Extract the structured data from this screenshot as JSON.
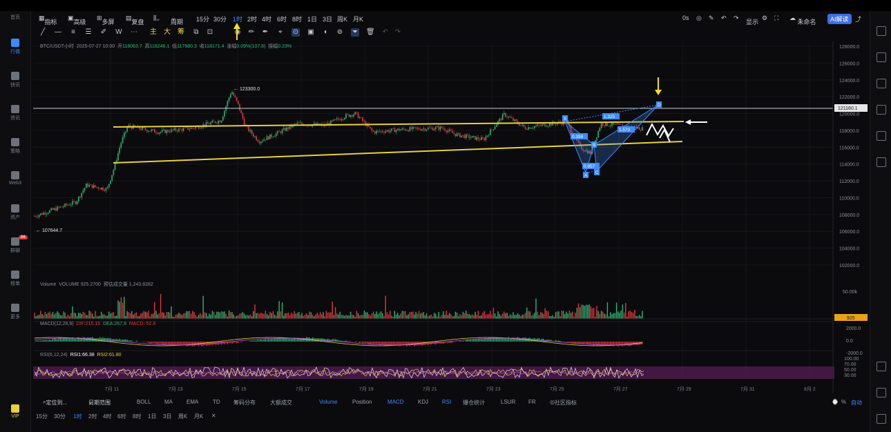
{
  "nav": {
    "home": "首页",
    "market": "行情",
    "news": "快讯",
    "info": "资讯",
    "strategy": "策略",
    "web3": "Web3",
    "assets": "资产",
    "social": "群聊",
    "rank": "榜单",
    "more": "更多",
    "vip": "VIP",
    "social_badge": "86"
  },
  "toolbar": {
    "indicators": "指标",
    "advanced": "高级",
    "multi": "多屏",
    "replay": "复盘",
    "period": "周期",
    "intervals": [
      "15分",
      "30分",
      "1时",
      "2时",
      "4时",
      "6时",
      "8时",
      "1日",
      "3日",
      "周K",
      "月K"
    ],
    "selected_interval": "1时",
    "zero_s": "0s",
    "display": "显示",
    "unnamed": "未命名",
    "ai": "AI解读",
    "main": "主",
    "large": "大",
    "chip": "筹"
  },
  "ohlc": {
    "symbol": "BTC/USDT小时",
    "time": "2025-07-27 10:00",
    "open_l": "开",
    "open": "118063.7",
    "high_l": "高",
    "high": "118246.1",
    "low_l": "低",
    "low": "117980.3",
    "close_l": "收",
    "close": "118171.4",
    "change_l": "涨幅",
    "change": "0.09%(107.8)",
    "amp_l": "振幅",
    "amp": "0.23%"
  },
  "price_axis": [
    "128000.0",
    "126000.0",
    "124000.0",
    "122000.0",
    "120000.0",
    "118000.0",
    "116000.0",
    "114000.0",
    "112000.0",
    "110000.0",
    "108000.0",
    "106000.0",
    "104000.0",
    "102000.0"
  ],
  "current_price": "121160.1",
  "annotations": {
    "high": "123300.0",
    "low": "107644.7",
    "x": "X",
    "a": "A",
    "b": "B",
    "c": "C",
    "d": "D",
    "r1": "0.398",
    "r2": "0.957",
    "r3": "1.573",
    "r4": "1.325"
  },
  "volume": {
    "label": "Volume",
    "value": "VOLUME 925.2700",
    "ma": "预估成交量 1,243.8282",
    "axis_top": "50.00k",
    "current": "925"
  },
  "macd": {
    "label": "MACD(12,26,9)",
    "dif": "DIF:215.15",
    "dea": "DEA:267.9",
    "macd": "MACD:-52.8",
    "axis": [
      "2000.0",
      "0.0",
      "-2000.0"
    ]
  },
  "rsi": {
    "label": "RSI(6,12,24)",
    "rsi1": "RSI1:66.38",
    "rsi2": "RSI2:61.80",
    "axis": [
      "100.00",
      "70.00",
      "50.00",
      "30.00"
    ]
  },
  "time_axis": [
    "7月 11",
    "7月 13",
    "7月 15",
    "7月 17",
    "7月 19",
    "7月 21",
    "7月 23",
    "7月 25",
    "7月 27",
    "7月 29",
    "7月 31",
    "8月 2"
  ],
  "bottom": {
    "fast_order": "定位到...",
    "date_range": "日期范围",
    "indicators": [
      "BOLL",
      "MA",
      "EMA",
      "TD",
      "筹码分布",
      "大额成交",
      "Volume",
      "Position",
      "MACD",
      "KDJ",
      "RSI",
      "爆仓统计",
      "LSUR",
      "FR",
      "社区指标"
    ],
    "active": [
      "Volume",
      "MACD",
      "RSI"
    ],
    "intervals": [
      "15分",
      "30分",
      "1时",
      "2时",
      "4时",
      "6时",
      "8时",
      "1日",
      "3日",
      "周K",
      "月K"
    ],
    "percent": "%",
    "auto": "自动"
  },
  "colors": {
    "up": "#2bb673",
    "down": "#e0383e",
    "accent": "#3d8bfd",
    "channel": "#e8d13a",
    "harmonic": "#3d8bfd"
  }
}
